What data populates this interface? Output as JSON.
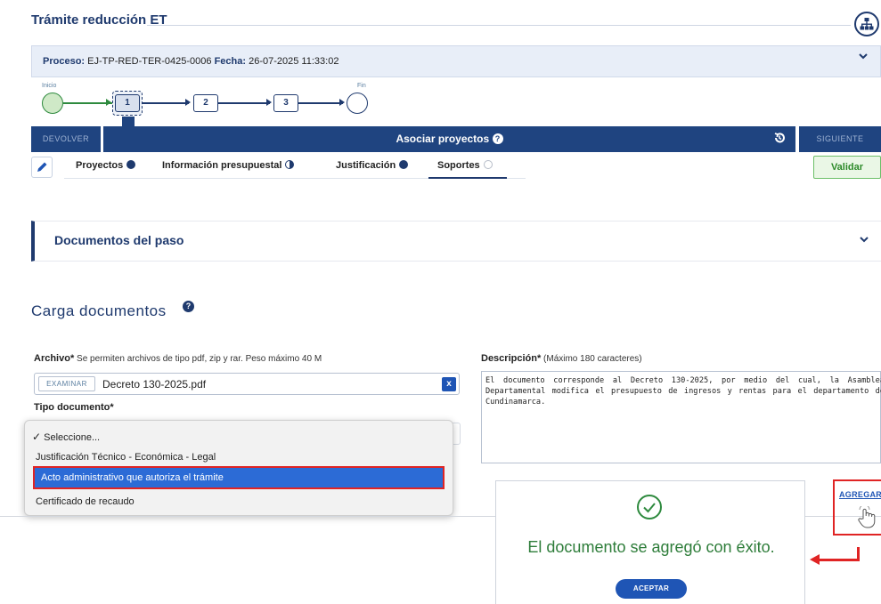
{
  "page": {
    "title": "Trámite reducción ET"
  },
  "process": {
    "label_proceso": "Proceso:",
    "proceso_value": "EJ-TP-RED-TER-0425-0006",
    "label_fecha": "Fecha:",
    "fecha_value": "26-07-2025 11:33:02"
  },
  "stepper": {
    "start_label": "Inicio",
    "end_label": "Fin",
    "steps": [
      "1",
      "2",
      "3"
    ]
  },
  "actionbar": {
    "devolver": "DEVOLVER",
    "title": "Asociar proyectos",
    "siguiente": "SIGUIENTE"
  },
  "tabs": [
    {
      "label": "Proyectos",
      "status": "complete"
    },
    {
      "label": "Información presupuestal",
      "status": "partial"
    },
    {
      "label": "Justificación",
      "status": "complete"
    },
    {
      "label": "Soportes",
      "status": "empty"
    }
  ],
  "validar_label": "Validar",
  "docs_panel": {
    "title": "Documentos del paso"
  },
  "carga": {
    "title": "Carga documentos",
    "archivo_label": "Archivo*",
    "archivo_hint": "Se permiten archivos de tipo pdf, zip y rar. Peso máximo 40 M",
    "examinar_label": "EXAMINAR",
    "file_name": "Decreto 130-2025.pdf",
    "clear_label": "x",
    "tipo_label": "Tipo documento*",
    "options": [
      "Seleccione...",
      "Justificación Técnico - Económica - Legal",
      "Acto administrativo que autoriza el trámite",
      "Certificado de recaudo"
    ],
    "highlighted_option": "Acto administrativo que autoriza el trámite",
    "descripcion_label": "Descripción*",
    "descripcion_hint": "(Máximo 180 caracteres)",
    "descripcion_text": "El documento corresponde al Decreto 130-2025, por medio del cual, la Asamblea Departamental modifica el presupuesto de ingresos y rentas para el departamento de Cundinamarca.",
    "agregar_label": "AGREGAR"
  },
  "modal": {
    "message": "El documento se agregó con éxito.",
    "accept_label": "ACEPTAR"
  },
  "colors": {
    "primary": "#1f3a6e",
    "bar": "#1f4480",
    "highlight": "#e02424",
    "success": "#2e7d3a"
  }
}
